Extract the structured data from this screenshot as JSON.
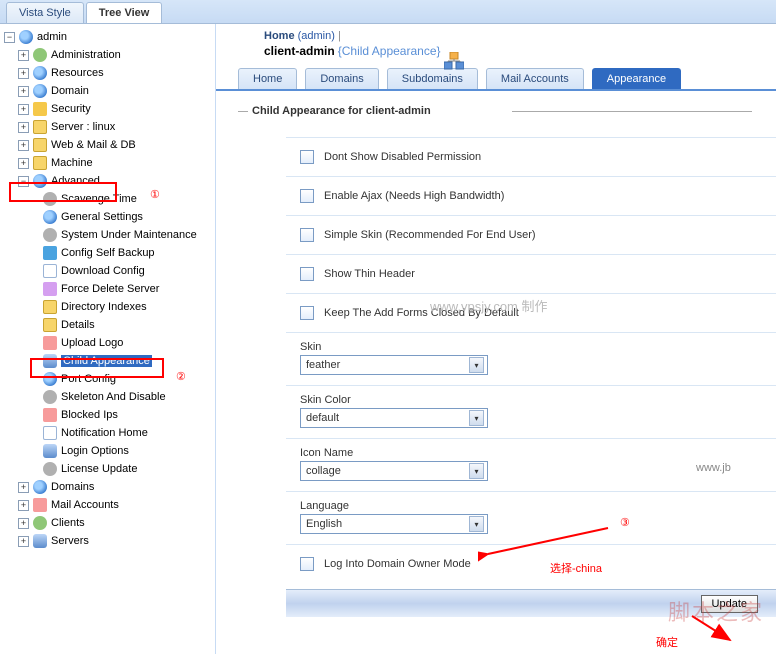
{
  "style_tabs": {
    "vista": "Vista Style",
    "tree": "Tree View"
  },
  "breadcrumb": {
    "home": "Home",
    "admin": "(admin)"
  },
  "page_title": {
    "name": "client-admin",
    "suffix": "{Child Appearance}"
  },
  "subtabs": {
    "home": "Home",
    "domains": "Domains",
    "subdomains": "Subdomains",
    "mail": "Mail Accounts",
    "appearance": "Appearance"
  },
  "section_title": "Child Appearance for client-admin",
  "tree": {
    "root": "admin",
    "items": [
      "Administration",
      "Resources",
      "Domain",
      "Security",
      "Server : linux",
      "Web & Mail & DB",
      "Machine",
      "Advanced"
    ],
    "advanced": [
      "Scavenge Time",
      "General Settings",
      "System Under Maintenance",
      "Config Self Backup",
      "Download Config",
      "Force Delete Server",
      "Directory Indexes",
      "Details",
      "Upload Logo",
      "Child Appearance",
      "Port Config",
      "Skeleton And Disable",
      "Blocked Ips",
      "Notification Home",
      "Login Options",
      "License Update"
    ],
    "bottom": [
      "Domains",
      "Mail Accounts",
      "Clients",
      "Servers"
    ]
  },
  "form": {
    "chk1": "Dont Show Disabled Permission",
    "chk2": "Enable Ajax (Needs High Bandwidth)",
    "chk3": "Simple Skin (Recommended For End User)",
    "chk4": "Show Thin Header",
    "chk5": "Keep The Add Forms Closed By Default",
    "skin_lbl": "Skin",
    "skin_val": "feather",
    "color_lbl": "Skin Color",
    "color_val": "default",
    "icon_lbl": "Icon Name",
    "icon_val": "collage",
    "lang_lbl": "Language",
    "lang_val": "English",
    "chk6": "Log Into Domain Owner Mode",
    "update": "Update"
  },
  "annotations": {
    "n1": "①",
    "n2": "②",
    "n3": "③",
    "select_china": "选择-china",
    "confirm": "确定"
  },
  "watermarks": {
    "vps": "www.vpsjy.com 制作",
    "jb": "脚本之家",
    "jb_url": "www.jb"
  }
}
